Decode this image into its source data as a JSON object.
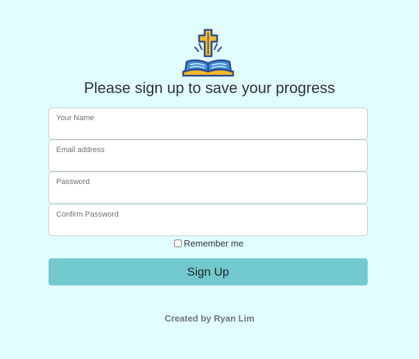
{
  "logo": {
    "icon": "cross-bible-icon",
    "colors": {
      "outline": "#2b4a8f",
      "gold": "#f5b82e",
      "blue": "#3f8fd8"
    }
  },
  "heading": "Please sign up to save your progress",
  "form": {
    "fields": [
      {
        "label": "Your Name",
        "value": ""
      },
      {
        "label": "Email address",
        "value": ""
      },
      {
        "label": "Password",
        "value": ""
      },
      {
        "label": "Confirm Password",
        "value": ""
      }
    ],
    "remember_label": "Remember me",
    "remember_checked": false,
    "submit_label": "Sign Up"
  },
  "footer": {
    "credit": "Created by Ryan Lim"
  },
  "colors": {
    "background": "#e0fcfc",
    "button": "#72c9cd"
  }
}
